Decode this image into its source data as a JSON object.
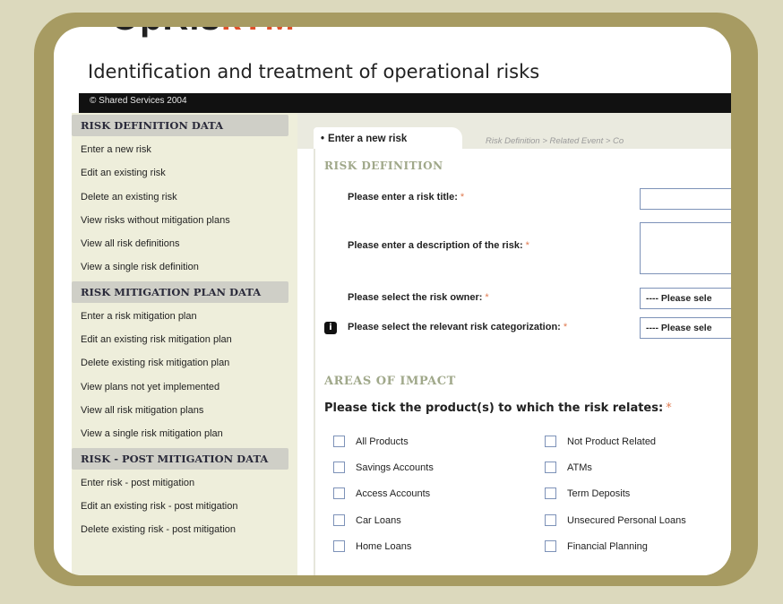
{
  "app": {
    "logo_dark": "OpRis",
    "logo_accent": "kTM",
    "subtitle": "Identification and treatment of operational risks",
    "copyright": "© Shared Services 2004"
  },
  "sidebar": {
    "sections": [
      {
        "title": "RISK DEFINITION DATA",
        "items": [
          "Enter a new risk",
          "Edit an existing risk",
          "Delete an existing risk",
          "View risks without mitigation plans",
          "View all risk definitions",
          "View a single risk definition"
        ]
      },
      {
        "title": "RISK MITIGATION PLAN DATA",
        "items": [
          "Enter a risk mitigation plan",
          "Edit an existing risk mitigation plan",
          "Delete existing risk mitigation plan",
          "View plans not yet implemented",
          "View all risk mitigation plans",
          "View a single risk mitigation plan"
        ]
      },
      {
        "title": "RISK - POST MITIGATION DATA",
        "items": [
          "Enter risk - post mitigation",
          "Edit an existing risk - post mitigation",
          "Delete existing risk - post mitigation"
        ]
      }
    ]
  },
  "main": {
    "tab_label": "Enter a new risk",
    "breadcrumb": "Risk Definition > Related Event > Co",
    "risk_definition": {
      "heading": "RISK DEFINITION",
      "title_label": "Please enter a risk title:",
      "desc_label": "Please enter a description of the risk:",
      "owner_label": "Please select the risk owner:",
      "owner_value": "---- Please sele",
      "category_label": "Please select the relevant risk categorization:",
      "category_value": "---- Please sele",
      "required_mark": "*"
    },
    "areas_of_impact": {
      "heading": "AREAS OF IMPACT",
      "question": "Please tick the product(s) to which the risk relates:",
      "col1": [
        "All Products",
        "Savings Accounts",
        "Access Accounts",
        "Car Loans",
        "Home Loans"
      ],
      "col2": [
        "Not Product Related",
        "ATMs",
        "Term Deposits",
        "Unsecured Personal Loans",
        "Financial Planning"
      ]
    }
  }
}
